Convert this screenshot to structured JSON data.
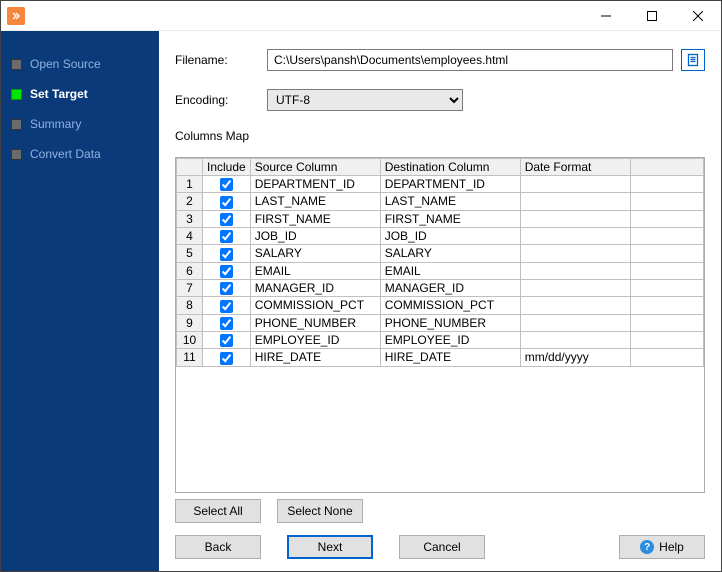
{
  "window": {},
  "sidebar": {
    "items": [
      {
        "label": "Open Source",
        "active": false
      },
      {
        "label": "Set Target",
        "active": true
      },
      {
        "label": "Summary",
        "active": false
      },
      {
        "label": "Convert Data",
        "active": false
      }
    ]
  },
  "form": {
    "filename_label": "Filename:",
    "filename_value": "C:\\Users\\pansh\\Documents\\employees.html",
    "encoding_label": "Encoding:",
    "encoding_value": "UTF-8",
    "columns_map_label": "Columns Map"
  },
  "grid": {
    "headers": {
      "include": "Include",
      "source": "Source Column",
      "destination": "Destination Column",
      "date_format": "Date Format"
    },
    "rows": [
      {
        "n": "1",
        "include": true,
        "src": "DEPARTMENT_ID",
        "dst": "DEPARTMENT_ID",
        "fmt": ""
      },
      {
        "n": "2",
        "include": true,
        "src": "LAST_NAME",
        "dst": "LAST_NAME",
        "fmt": ""
      },
      {
        "n": "3",
        "include": true,
        "src": "FIRST_NAME",
        "dst": "FIRST_NAME",
        "fmt": ""
      },
      {
        "n": "4",
        "include": true,
        "src": "JOB_ID",
        "dst": "JOB_ID",
        "fmt": ""
      },
      {
        "n": "5",
        "include": true,
        "src": "SALARY",
        "dst": "SALARY",
        "fmt": ""
      },
      {
        "n": "6",
        "include": true,
        "src": "EMAIL",
        "dst": "EMAIL",
        "fmt": ""
      },
      {
        "n": "7",
        "include": true,
        "src": "MANAGER_ID",
        "dst": "MANAGER_ID",
        "fmt": ""
      },
      {
        "n": "8",
        "include": true,
        "src": "COMMISSION_PCT",
        "dst": "COMMISSION_PCT",
        "fmt": ""
      },
      {
        "n": "9",
        "include": true,
        "src": "PHONE_NUMBER",
        "dst": "PHONE_NUMBER",
        "fmt": ""
      },
      {
        "n": "10",
        "include": true,
        "src": "EMPLOYEE_ID",
        "dst": "EMPLOYEE_ID",
        "fmt": ""
      },
      {
        "n": "11",
        "include": true,
        "src": "HIRE_DATE",
        "dst": "HIRE_DATE",
        "fmt": "mm/dd/yyyy"
      }
    ]
  },
  "buttons": {
    "select_all": "Select All",
    "select_none": "Select None",
    "back": "Back",
    "next": "Next",
    "cancel": "Cancel",
    "help": "Help"
  }
}
